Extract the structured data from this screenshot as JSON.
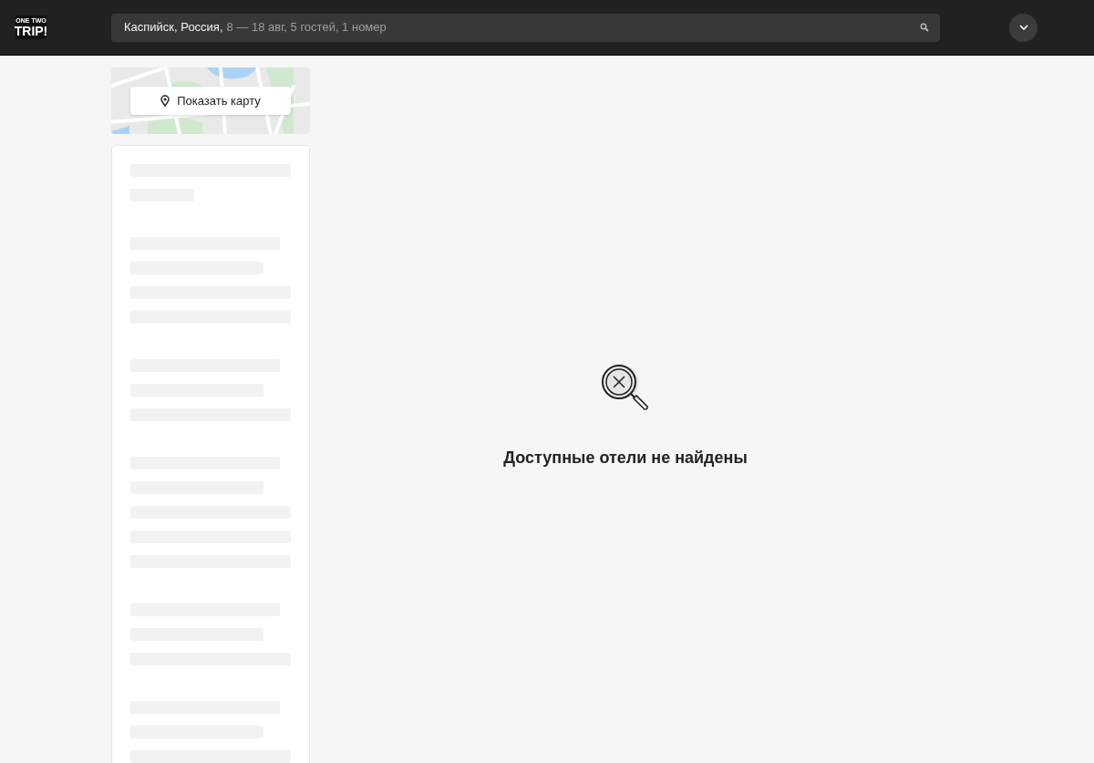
{
  "header": {
    "logo": {
      "line_1": "ONE TWO",
      "line_2": "TRIP!"
    },
    "search": {
      "destination": "Каспийск, Россия,",
      "details": "8 — 18 авг, 5 гостей, 1 номер"
    }
  },
  "map_card": {
    "button": "Показать карту"
  },
  "empty_state": {
    "message": "Доступные отели не найдены"
  }
}
